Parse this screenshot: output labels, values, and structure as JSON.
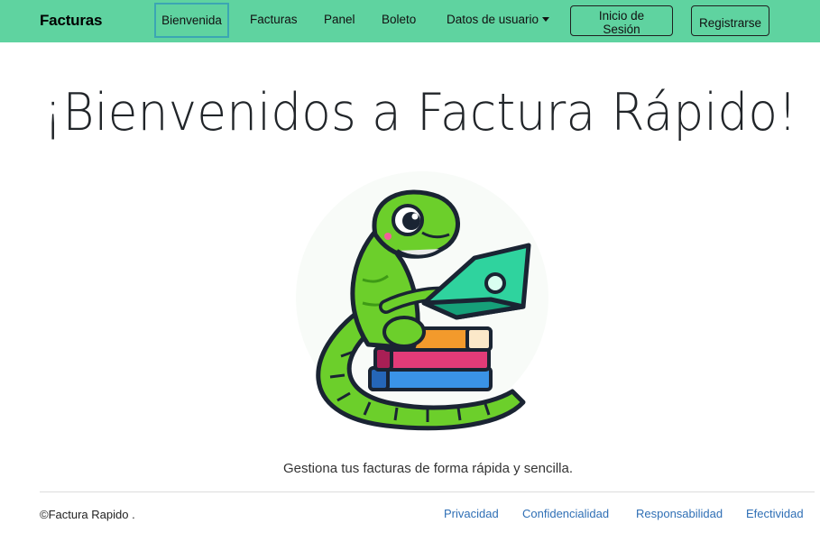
{
  "navbar": {
    "brand": "Facturas",
    "links": {
      "bienvenida": "Bienvenida",
      "facturas": "Facturas",
      "panel": "Panel",
      "boleto": "Boleto",
      "datos_usuario": "Datos de usuario"
    },
    "login_label": "Inicio de Sesión",
    "register_label": "Registrarse",
    "background_color": "#5fd3a0",
    "active_outline_color": "#3ba6b3"
  },
  "main": {
    "heading": "¡Bienvenidos a Factura Rápido!",
    "hero_image": "lizard-with-laptop-on-books-illustration",
    "tagline": "Gestiona tus facturas de forma rápida y sencilla."
  },
  "footer": {
    "copyright": "©Factura Rapido .",
    "links": {
      "privacidad": "Privacidad",
      "confidencialidad": "Confidencialidad",
      "responsabilidad": "Responsabilidad",
      "efectividad": "Efectividad"
    },
    "link_color": "#2f6fb5"
  }
}
